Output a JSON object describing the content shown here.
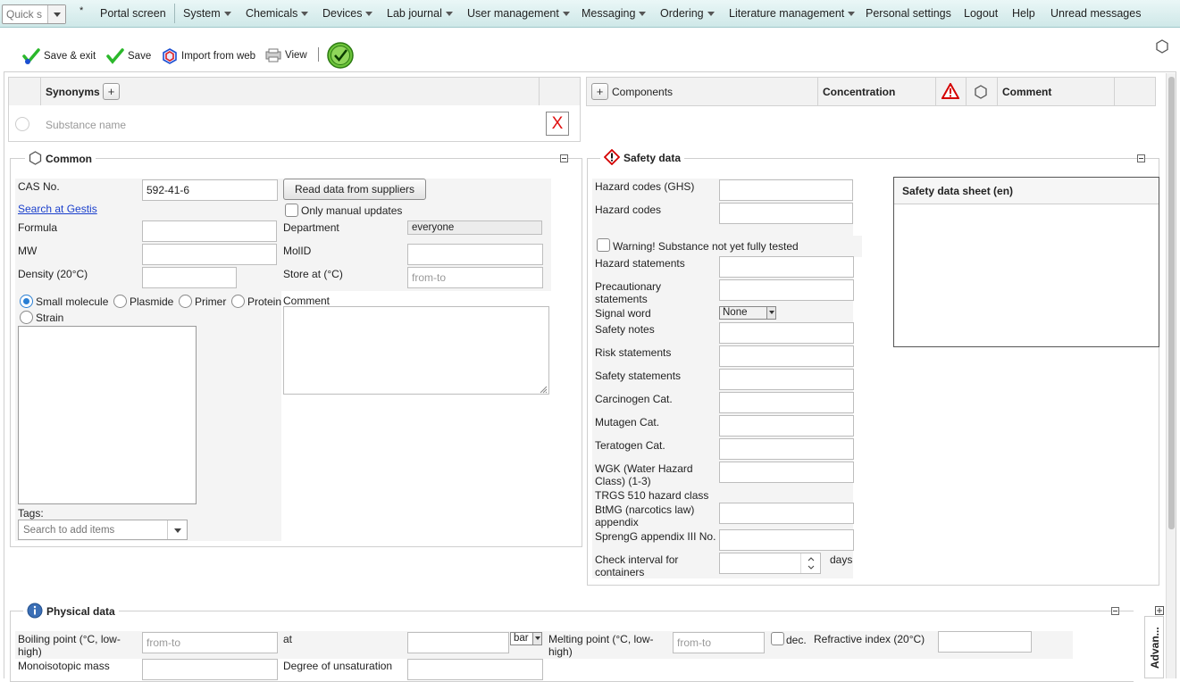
{
  "menubar": {
    "quick_search_placeholder": "Quick s",
    "star": "*",
    "portal": "Portal screen",
    "items": [
      "System",
      "Chemicals",
      "Devices",
      "Lab journal",
      "User management",
      "Messaging",
      "Ordering",
      "Literature management"
    ],
    "plain_items": [
      "Personal settings",
      "Logout",
      "Help",
      "Unread messages"
    ]
  },
  "toolbar": {
    "save_exit": "Save & exit",
    "save": "Save",
    "import_web": "Import from web",
    "view": "View"
  },
  "synonyms": {
    "header": "Synonyms",
    "plus": "+",
    "substance_placeholder": "Substance name",
    "remove": "X"
  },
  "components": {
    "plus": "+",
    "header": "Components",
    "concentration": "Concentration",
    "comment": "Comment"
  },
  "common": {
    "legend": "Common",
    "cas_label": "CAS No.",
    "cas_value": "592-41-6",
    "read_suppliers": "Read data from suppliers",
    "gestis_link": "Search at Gestis",
    "only_manual": "Only manual updates",
    "formula_label": "Formula",
    "department_label": "Department",
    "department_value": "everyone",
    "mw_label": "MW",
    "molid_label": "MolID",
    "density_label": "Density (20°C)",
    "store_label": "Store at (°C)",
    "store_placeholder": "from-to",
    "types": [
      "Small molecule",
      "Plasmide",
      "Primer",
      "Protein",
      "Strain"
    ],
    "selected_type": "Small molecule",
    "comment_label": "Comment",
    "tags_label": "Tags:",
    "tags_placeholder": "Search to add items"
  },
  "safety": {
    "legend": "Safety data",
    "ghs_label": "Hazard codes (GHS)",
    "hazard_codes_label": "Hazard codes",
    "warning_label": "Warning! Substance not yet fully tested",
    "hazard_statements": "Hazard statements",
    "precautionary_line1": "Precautionary",
    "precautionary_line2": "statements",
    "signal_word_label": "Signal word",
    "signal_word_value": "None",
    "safety_notes": "Safety notes",
    "risk_statements": "Risk statements",
    "safety_statements": "Safety statements",
    "carcinogen": "Carcinogen Cat.",
    "mutagen": "Mutagen Cat.",
    "teratogen": "Teratogen Cat.",
    "wgk_line1": "WGK (Water Hazard",
    "wgk_line2": "Class) (1-3)",
    "trgs": "TRGS 510 hazard class",
    "btmg_line1": "BtMG (narcotics law)",
    "btmg_line2": "appendix",
    "sprengg": "SprengG appendix III No.",
    "check_line1": "Check interval for",
    "check_line2": "containers",
    "days": "days",
    "sds_header": "Safety data sheet (en)"
  },
  "physical": {
    "legend": "Physical data",
    "boiling_line1": "Boiling point (°C, low-",
    "boiling_line2": "high)",
    "boiling_placeholder": "from-to",
    "at_label": "at",
    "unit_value": "bar",
    "melting_line1": "Melting point (°C, low-",
    "melting_line2": "high)",
    "melting_placeholder": "from-to",
    "dec_label": "dec.",
    "refractive_label": "Refractive index (20°C)",
    "monoisotopic_label": "Monoisotopic mass",
    "unsaturation_label": "Degree of unsaturation",
    "advanced_tab": "Advan..."
  },
  "colors": {
    "menubar_top": "#eaf7f7",
    "menubar_bottom": "#cfe8e8",
    "link": "#1a3fcc",
    "warning_red": "#cc0000",
    "radio_blue": "#2a7fd4"
  }
}
